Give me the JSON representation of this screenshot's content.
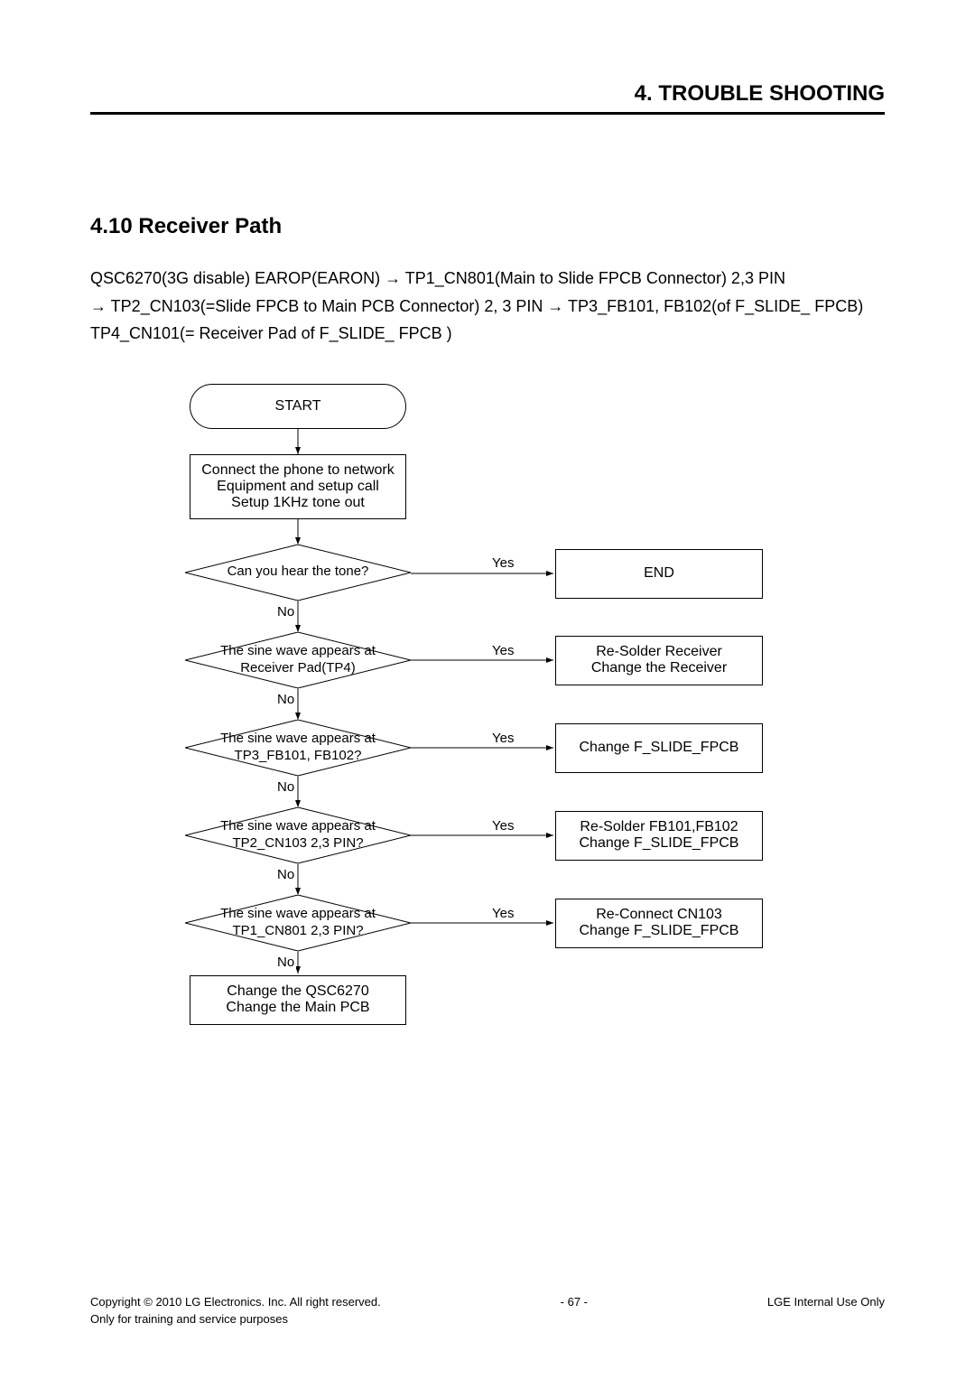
{
  "header": {
    "title": "4. TROUBLE SHOOTING"
  },
  "section": {
    "title": "4.10 Receiver Path"
  },
  "intro": {
    "l1": "QSC6270(3G disable) EAROP(EARON) → TP1_CN801(Main to Slide FPCB Connector) 2,3 PIN",
    "l2": "→ TP2_CN103(=Slide FPCB to Main PCB Connector) 2, 3 PIN → TP3_FB101, FB102(of  F_SLIDE_ FPCB)",
    "l3": "TP4_CN101(= Receiver Pad of  F_SLIDE_ FPCB )"
  },
  "flow": {
    "start": "START",
    "setup_l1": "Connect the phone to network",
    "setup_l2": "Equipment and setup call",
    "setup_l3": "Setup 1KHz tone out",
    "d1": "Can you hear the tone?",
    "end": "END",
    "d2_l1": "The sine wave appears at",
    "d2_l2": "Receiver Pad(TP4)",
    "a2_l1": "Re-Solder Receiver",
    "a2_l2": "Change the Receiver",
    "d3_l1": "The sine wave appears at",
    "d3_l2": "TP3_FB101, FB102?",
    "a3_l1": "Change F_SLIDE_FPCB",
    "d4_l1": "The sine wave appears at",
    "d4_l2": "TP2_CN103 2,3 PIN?",
    "a4_l1": "Re-Solder FB101,FB102",
    "a4_l2": "Change F_SLIDE_FPCB",
    "d5_l1": "The sine wave appears at",
    "d5_l2": "TP1_CN801 2,3 PIN?",
    "a5_l1": "Re-Connect CN103",
    "a5_l2": "Change F_SLIDE_FPCB",
    "final_l1": "Change the QSC6270",
    "final_l2": "Change the Main PCB",
    "yes": "Yes",
    "no": "No"
  },
  "footer": {
    "copy_l1": "Copyright © 2010 LG Electronics. Inc. All right reserved.",
    "copy_l2": "Only for training and service purposes",
    "page": "- 67 -",
    "right": "LGE Internal Use Only"
  }
}
